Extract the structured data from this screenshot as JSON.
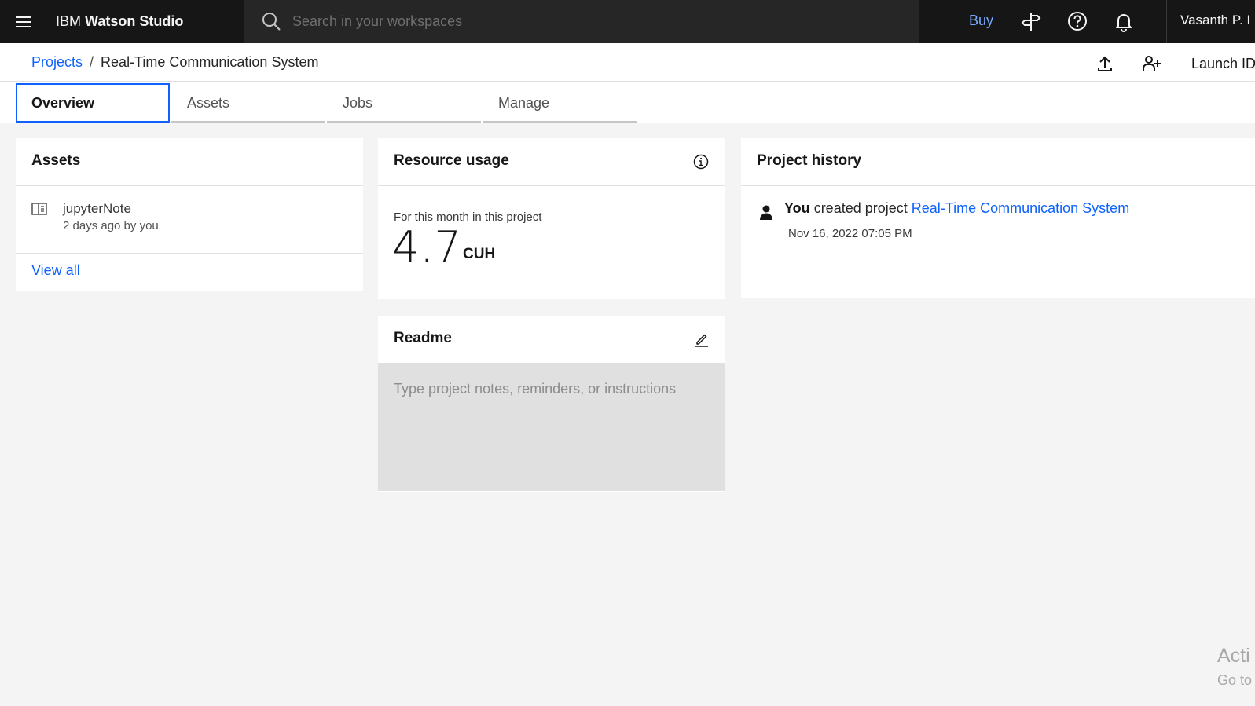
{
  "app": {
    "brand_prefix": "IBM",
    "brand_name": "Watson Studio"
  },
  "topbar": {
    "search_placeholder": "Search in your workspaces",
    "buy_label": "Buy",
    "user_name": "Vasanth P. I",
    "icons": [
      "menu-icon",
      "search-icon",
      "signpost-icon",
      "help-icon",
      "notification-icon"
    ]
  },
  "breadcrumb": {
    "projects_label": "Projects",
    "separator": "/",
    "current": "Real-Time Communication System"
  },
  "header_actions": {
    "launch_label": "Launch ID",
    "icons": [
      "upload-icon",
      "add-collaborator-icon"
    ]
  },
  "tabs": [
    {
      "label": "Overview",
      "active": true
    },
    {
      "label": "Assets",
      "active": false
    },
    {
      "label": "Jobs",
      "active": false
    },
    {
      "label": "Manage",
      "active": false
    }
  ],
  "assets_card": {
    "title": "Assets",
    "items": [
      {
        "name": "jupyterNote",
        "meta": "2 days ago by you",
        "icon": "notebook-icon"
      }
    ],
    "view_all_label": "View all"
  },
  "resource_usage": {
    "title": "Resource usage",
    "label": "For this month in this project",
    "value": "4.7",
    "unit": "CUH"
  },
  "readme": {
    "title": "Readme",
    "placeholder": "Type project notes, reminders, or instructions"
  },
  "project_history": {
    "title": "Project history",
    "entries": [
      {
        "actor": "You",
        "action": "created project",
        "target": "Real-Time Communication System",
        "timestamp": "Nov 16, 2022 07:05 PM"
      }
    ]
  },
  "watermark": {
    "line1": "Acti",
    "line2": "Go to"
  },
  "colors": {
    "topbar_bg": "#161616",
    "accent": "#0f62fe",
    "buy": "#78a9ff",
    "page_bg": "#f4f4f4"
  }
}
